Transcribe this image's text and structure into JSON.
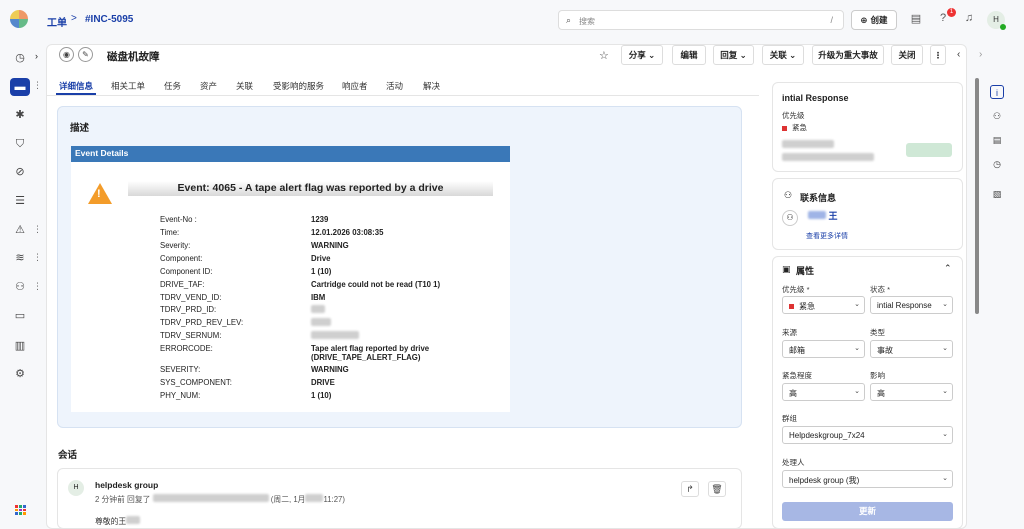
{
  "header": {
    "breadcrumb_1": "工单",
    "breadcrumb_sep": ">",
    "breadcrumb_2": "#INC-5095",
    "search_placeholder": "搜索",
    "search_shortcut": "/",
    "create_label": "创建",
    "notification_count": "1",
    "avatar_initial": "H"
  },
  "ticket": {
    "title": "磁盘机故障",
    "buttons": [
      "分享",
      "编辑",
      "回复",
      "关联",
      "升级为重大事故",
      "关闭"
    ],
    "tabs": [
      "详细信息",
      "相关工单",
      "任务",
      "资产",
      "关联",
      "受影响的服务",
      "响应者",
      "活动",
      "解决"
    ]
  },
  "description": {
    "title": "描述",
    "event_header": "Event Details",
    "event_banner": "Event: 4065 - A tape alert flag was reported by a drive",
    "rows": [
      {
        "k": "Event-No :",
        "v": "1239"
      },
      {
        "k": "Time:",
        "v": "12.01.2026 03:08:35"
      },
      {
        "k": "Severity:",
        "v": "WARNING"
      },
      {
        "k": "Component:",
        "v": "Drive"
      },
      {
        "k": "Component ID:",
        "v": "1 (10)"
      },
      {
        "k": "DRIVE_TAF:",
        "v": "Cartridge could not be read (T10 1)"
      },
      {
        "k": "TDRV_VEND_ID:",
        "v": "IBM"
      },
      {
        "k": "TDRV_PRD_ID:",
        "v": ""
      },
      {
        "k": "TDRV_PRD_REV_LEV:",
        "v": ""
      },
      {
        "k": "TDRV_SERNUM:",
        "v": ""
      },
      {
        "k": "ERRORCODE:",
        "v": "Tape alert flag reported by drive"
      },
      {
        "k": "",
        "v": "(DRIVE_TAPE_ALERT_FLAG)"
      },
      {
        "k": "SEVERITY:",
        "v": "WARNING"
      },
      {
        "k": "SYS_COMPONENT:",
        "v": "DRIVE"
      },
      {
        "k": "PHY_NUM:",
        "v": "1 (10)"
      }
    ]
  },
  "conversation": {
    "title": "会话",
    "author": "helpdesk group",
    "avatar_initial": "H",
    "meta_prefix": "2 分钟前 回复了",
    "meta_date_a": "(周二, 1月",
    "meta_date_b": "11:27)",
    "body": "尊敬的王"
  },
  "sidebar": {
    "response_title": "intial Response",
    "priority_label": "优先级",
    "priority_value": "紧急",
    "contact_title": "联系信息",
    "contact_name": "王",
    "contact_more": "查看更多详情",
    "props_title": "属性",
    "priority_field_label": "优先级 *",
    "priority_field_value": "紧急",
    "status_label": "状态 *",
    "status_value": "intial Response",
    "source_label": "来源",
    "source_value": "邮箱",
    "type_label": "类型",
    "type_value": "事故",
    "urgency_label": "紧急程度",
    "urgency_value": "高",
    "impact_label": "影响",
    "impact_value": "高",
    "group_label": "群组",
    "group_value": "Helpdeskgroup_7x24",
    "assignee_label": "处理人",
    "assignee_value": "helpdesk group (我)",
    "update_label": "更新"
  },
  "colors": {
    "accent": "#1a3fa8",
    "event_header": "#3a78b8",
    "warning": "#f39c2a",
    "priority": "#dd3333"
  }
}
